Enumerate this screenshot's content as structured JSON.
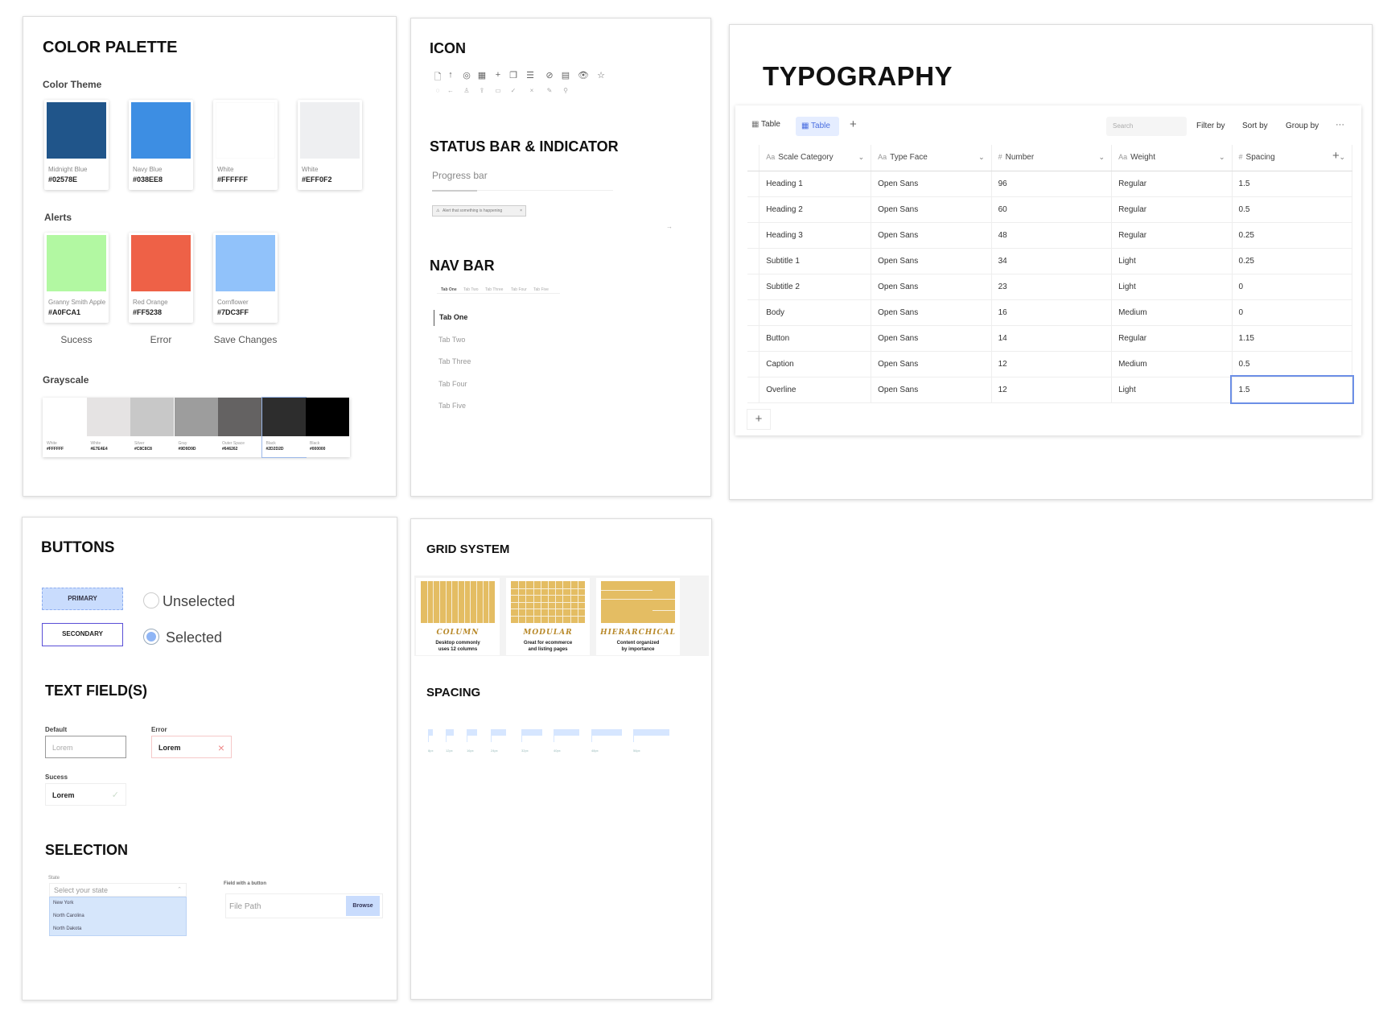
{
  "color_palette": {
    "title": "COLOR PALETTE",
    "theme_label": "Color Theme",
    "theme": [
      {
        "name": "Midnight Blue",
        "hex": "#02578E",
        "color": "#20558a"
      },
      {
        "name": "Navy Blue",
        "hex": "#038EE8",
        "color": "#3d8ee3"
      },
      {
        "name": "White",
        "hex": "#FFFFFF",
        "color": "#ffffff"
      },
      {
        "name": "White",
        "hex": "#EFF0F2",
        "color": "#eeeff1"
      }
    ],
    "alerts_label": "Alerts",
    "alerts": [
      {
        "name": "Granny Smith Apple",
        "hex": "#A0FCA1",
        "color": "#b2f8a2",
        "label": "Sucess"
      },
      {
        "name": "Red Orange",
        "hex": "#FF5238",
        "color": "#ee6147",
        "label": "Error"
      },
      {
        "name": "Cornflower",
        "hex": "#7DC3FF",
        "color": "#91c2fa",
        "label": "Save Changes"
      }
    ],
    "grayscale_label": "Grayscale",
    "grayscale": [
      {
        "name": "White",
        "hex": "#FFFFFF",
        "color": "#ffffff"
      },
      {
        "name": "White",
        "hex": "#E7E4E4",
        "color": "#e5e3e3"
      },
      {
        "name": "Silver",
        "hex": "#C8C8C8",
        "color": "#c8c8c8"
      },
      {
        "name": "Gray",
        "hex": "#9D9D9D",
        "color": "#9d9d9d"
      },
      {
        "name": "Outer Space",
        "hex": "#646262",
        "color": "#646262"
      },
      {
        "name": "Black",
        "hex": "#2D2D2D",
        "color": "#2d2d2d"
      },
      {
        "name": "Black",
        "hex": "#000000",
        "color": "#000000"
      }
    ]
  },
  "icon": {
    "title": "ICON",
    "row1": [
      "🗋",
      "↑",
      "◎",
      "▦",
      "+",
      "❐",
      "☰",
      "⊘",
      "▤",
      "👁",
      "☆"
    ],
    "row2": [
      "◌",
      "←",
      "♙",
      "⇪",
      "▭",
      "✓",
      "×",
      "✎",
      "⚲"
    ]
  },
  "status": {
    "title": "STATUS BAR & INDICATOR",
    "progress_label": "Progress bar",
    "alert_text": "Alert that something is happening",
    "alert_close": "×"
  },
  "navbar": {
    "title": "NAV BAR",
    "tabs": [
      "Tab One",
      "Tab Two",
      "Tab Three",
      "Tab Four",
      "Tab Five"
    ]
  },
  "typography": {
    "title": "TYPOGRAPHY",
    "toolbar": {
      "view1": "Table",
      "view2": "Table",
      "add": "+",
      "search_placeholder": "Search",
      "filter": "Filter by",
      "sort": "Sort by",
      "group": "Group by",
      "more": "···"
    },
    "columns": [
      {
        "tag": "Aa",
        "label": "Scale Category"
      },
      {
        "tag": "Aa",
        "label": "Type Face"
      },
      {
        "tag": "#",
        "label": "Number"
      },
      {
        "tag": "Aa",
        "label": "Weight"
      },
      {
        "tag": "#",
        "label": "Spacing"
      }
    ],
    "rows": [
      [
        "Heading 1",
        "Open Sans",
        "96",
        "Regular",
        "1.5"
      ],
      [
        "Heading 2",
        "Open Sans",
        "60",
        "Regular",
        "0.5"
      ],
      [
        "Heading 3",
        "Open Sans",
        "48",
        "Regular",
        "0.25"
      ],
      [
        "Subtitle 1",
        "Open Sans",
        "34",
        "Light",
        "0.25"
      ],
      [
        "Subtitle 2",
        "Open Sans",
        "23",
        "Light",
        "0"
      ],
      [
        "Body",
        "Open Sans",
        "16",
        "Medium",
        "0"
      ],
      [
        "Button",
        "Open Sans",
        "14",
        "Regular",
        "1.15"
      ],
      [
        "Caption",
        "Open Sans",
        "12",
        "Medium",
        "0.5"
      ],
      [
        "Overline",
        "Open Sans",
        "12",
        "Light",
        "1.5"
      ]
    ],
    "add_col": "+",
    "add_row": "+"
  },
  "buttons": {
    "title": "BUTTONS",
    "primary": "PRIMARY",
    "secondary": "SECONDARY",
    "unselected": "Unselected",
    "selected": "Selected"
  },
  "textfields": {
    "title": "TEXT FIELD(S)",
    "default_label": "Default",
    "default_placeholder": "Lorem",
    "error_label": "Error",
    "error_value": "Lorem",
    "success_label": "Sucess",
    "success_value": "Lorem"
  },
  "selection": {
    "title": "SELECTION",
    "state_label": "State",
    "state_placeholder": "Select your state",
    "options": [
      "New York",
      "North Carolina",
      "North Dakota"
    ],
    "field_label": "Field with a button",
    "field_placeholder": "File Path",
    "browse": "Browse"
  },
  "grid": {
    "title": "GRID SYSTEM",
    "items": [
      {
        "name": "COLUMN",
        "desc1": "Desktop commonly",
        "desc2": "uses 12 columns"
      },
      {
        "name": "MODULAR",
        "desc1": "Great for ecommerce",
        "desc2": "and listing pages"
      },
      {
        "name": "HIERARCHICAL",
        "desc1": "Content organized",
        "desc2": "by importance"
      }
    ]
  },
  "spacing": {
    "title": "SPACING",
    "labels": [
      "8px",
      "12px",
      "16px",
      "24px",
      "32px",
      "40px",
      "48px",
      "56px"
    ]
  }
}
